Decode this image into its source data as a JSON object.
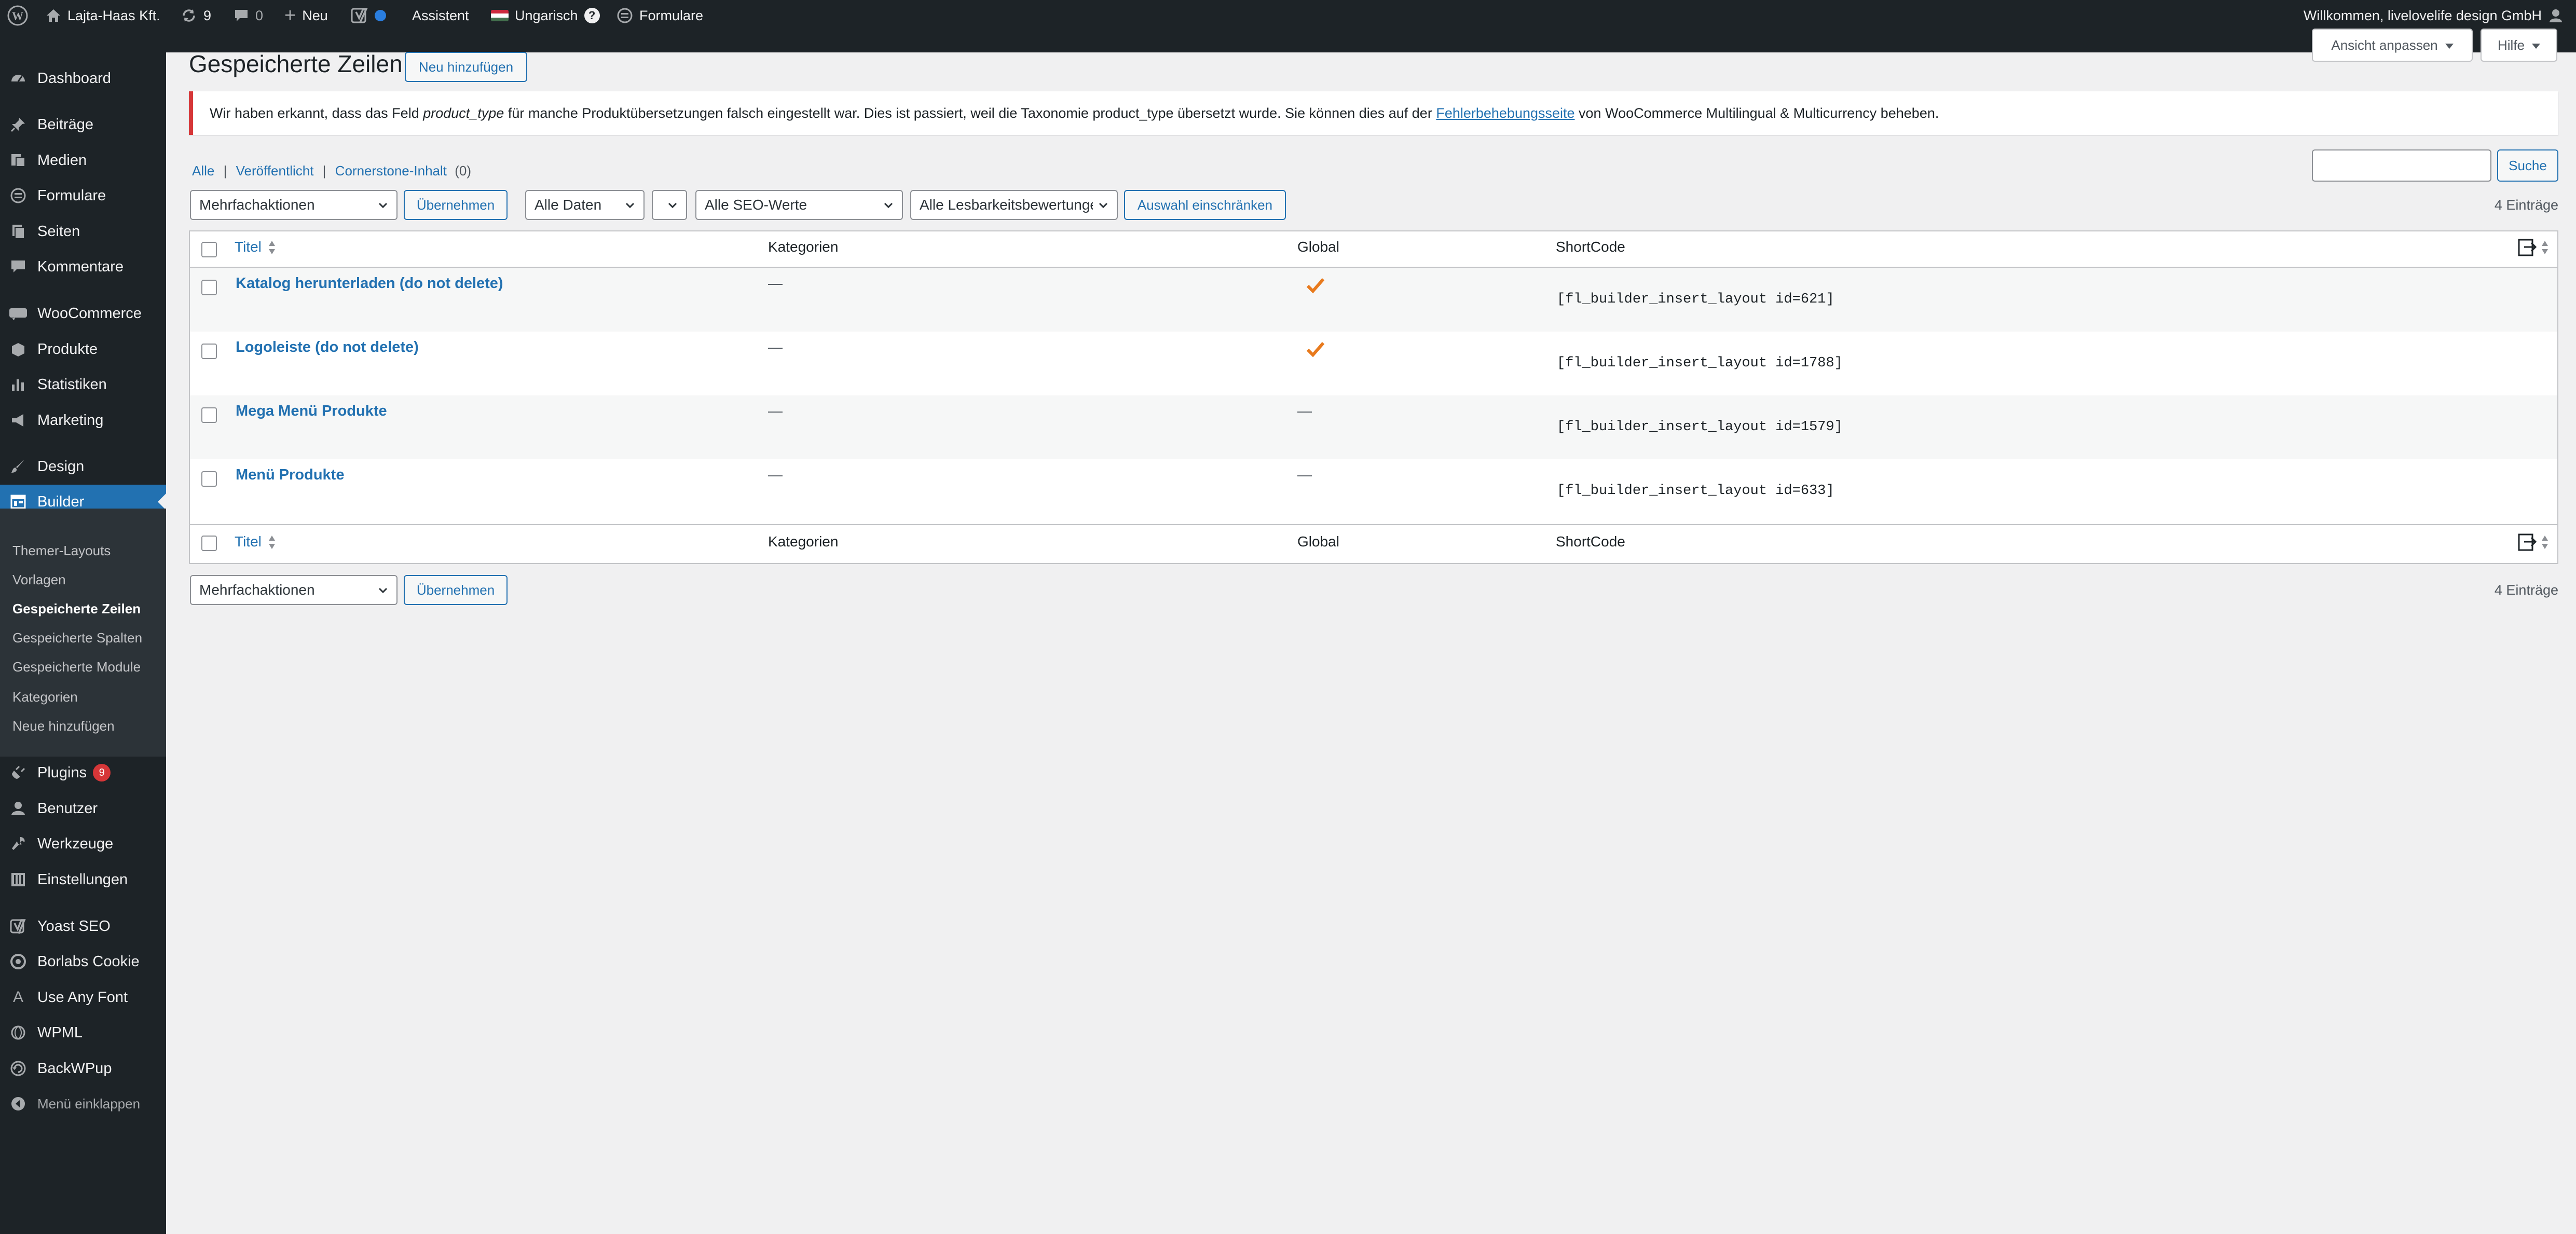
{
  "adminbar": {
    "site_name": "Lajta-Haas Kft.",
    "updates_count": "9",
    "comments_count": "0",
    "new_label": "Neu",
    "assistant_label": "Assistent",
    "language_label": "Ungarisch",
    "help_glyph": "?",
    "forms_label": "Formulare",
    "greeting": "Willkommen, livelovelife design GmbH"
  },
  "sidebar": {
    "items": [
      {
        "label": "Dashboard",
        "icon": "dashboard-icon"
      },
      {
        "label": "Beiträge",
        "icon": "pin-icon"
      },
      {
        "label": "Medien",
        "icon": "media-icon"
      },
      {
        "label": "Formulare",
        "icon": "forms-icon"
      },
      {
        "label": "Seiten",
        "icon": "pages-icon"
      },
      {
        "label": "Kommentare",
        "icon": "comments-icon"
      },
      {
        "label": "WooCommerce",
        "icon": "woocommerce-icon"
      },
      {
        "label": "Produkte",
        "icon": "products-icon"
      },
      {
        "label": "Statistiken",
        "icon": "chart-icon"
      },
      {
        "label": "Marketing",
        "icon": "megaphone-icon"
      },
      {
        "label": "Design",
        "icon": "brush-icon"
      },
      {
        "label": "Builder",
        "icon": "builder-icon"
      },
      {
        "label": "Plugins",
        "icon": "plugin-icon",
        "badge": "9"
      },
      {
        "label": "Benutzer",
        "icon": "users-icon"
      },
      {
        "label": "Werkzeuge",
        "icon": "tools-icon"
      },
      {
        "label": "Einstellungen",
        "icon": "settings-icon"
      },
      {
        "label": "Yoast SEO",
        "icon": "yoast-icon"
      },
      {
        "label": "Borlabs Cookie",
        "icon": "cookie-icon"
      },
      {
        "label": "Use Any Font",
        "icon": "font-icon",
        "glyph": "A"
      },
      {
        "label": "WPML",
        "icon": "wpml-icon"
      },
      {
        "label": "BackWPup",
        "icon": "backwpup-icon"
      },
      {
        "label": "Menü einklappen",
        "icon": "collapse-icon"
      }
    ],
    "builder_submenu": [
      "Themer-Layouts",
      "Vorlagen",
      "Gespeicherte Zeilen",
      "Gespeicherte Spalten",
      "Gespeicherte Module",
      "Kategorien",
      "Neue hinzufügen"
    ]
  },
  "screen_options": {
    "label": "Ansicht anpassen"
  },
  "help": {
    "label": "Hilfe"
  },
  "page": {
    "title": "Gespeicherte Zeilen",
    "add_new": "Neu hinzufügen"
  },
  "notice": {
    "part1": "Wir haben erkannt, dass das Feld ",
    "field": "product_type",
    "part2": " für manche Produktübersetzungen falsch eingestellt war. Dies ist passiert, weil die Taxonomie product_type übersetzt wurde. Sie können dies auf der ",
    "link": "Fehlerbehebungsseite",
    "part3": " von WooCommerce Multilingual & Multicurrency beheben."
  },
  "views": {
    "all": "Alle",
    "published": "Veröffentlicht",
    "cornerstone": "Cornerstone-Inhalt",
    "cornerstone_count": "(0)",
    "separator": "|"
  },
  "filters": {
    "bulk_action": "Mehrfachaktionen",
    "apply": "Übernehmen",
    "dates": "Alle Daten",
    "seo": "Alle SEO-Werte",
    "readability": "Alle Lesbarkeitsbewertungen",
    "filter_button": "Auswahl einschränken"
  },
  "search": {
    "button": "Suche"
  },
  "items_count": "4 Einträge",
  "table": {
    "columns": {
      "title": "Titel",
      "categories": "Kategorien",
      "global": "Global",
      "shortcode": "ShortCode"
    },
    "rows": [
      {
        "title": "Katalog herunterladen (do not delete)",
        "categories": "—",
        "global": true,
        "shortcode": "[fl_builder_insert_layout id=621]"
      },
      {
        "title": "Logoleiste (do not delete)",
        "categories": "—",
        "global": true,
        "shortcode": "[fl_builder_insert_layout id=1788]"
      },
      {
        "title": "Mega Menü Produkte",
        "categories": "—",
        "global": false,
        "shortcode": "[fl_builder_insert_layout id=1579]"
      },
      {
        "title": "Menü Produkte",
        "categories": "—",
        "global": false,
        "shortcode": "[fl_builder_insert_layout id=633]"
      }
    ],
    "dash": "—",
    "check_color": "#e87a1d"
  },
  "colors": {
    "accent": "#2271b1",
    "sidebar_bg": "#1d2327",
    "notice_border": "#d63638"
  }
}
